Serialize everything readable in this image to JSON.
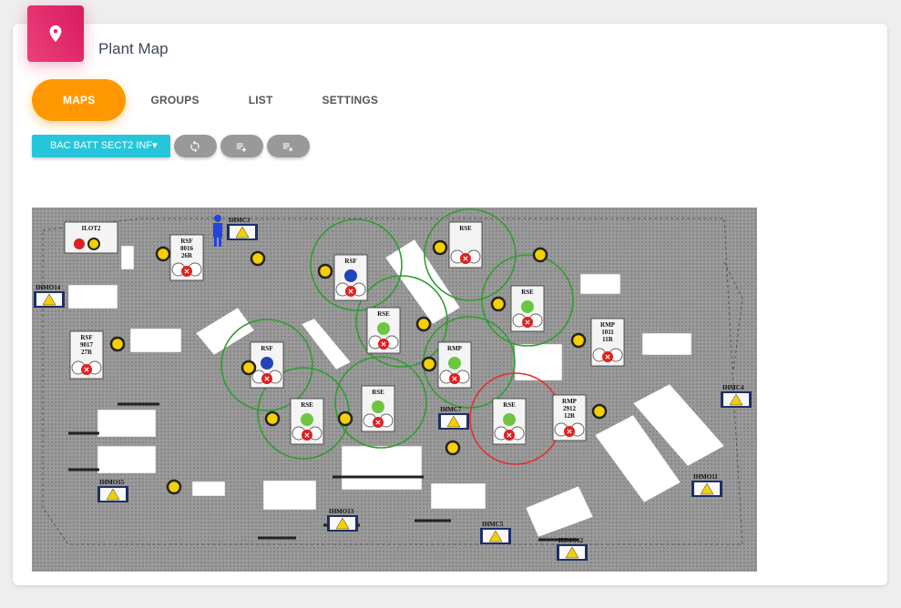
{
  "header": {
    "title": "Plant Map",
    "icon": "map-marker-icon",
    "accent": "#e91e63"
  },
  "tabs": [
    {
      "label": "MAPS",
      "active": true
    },
    {
      "label": "GROUPS",
      "active": false
    },
    {
      "label": "LIST",
      "active": false
    },
    {
      "label": "SETTINGS",
      "active": false
    }
  ],
  "toolbar": {
    "area_selected": "BAC BATT SECT2 INF",
    "buttons": [
      "refresh-icon",
      "list-add-icon",
      "list-clear-icon"
    ]
  },
  "colors": {
    "tab_active": "#ff9800",
    "dropdown": "#26c6da",
    "ring_ok": "#2e9e2e",
    "ring_alarm": "#e03030"
  },
  "map": {
    "hmi_panels": [
      "IHMC3",
      "IHMO14",
      "IHMC4",
      "IHMC7",
      "IHMO15",
      "IHMO11",
      "IHMO13",
      "IHMC5",
      "IHMO12"
    ],
    "stations": [
      {
        "label": "ILOT2",
        "l2": "",
        "l3": ""
      },
      {
        "label": "RSF",
        "l2": "8016",
        "l3": "26R"
      },
      {
        "label": "RSF",
        "l2": "",
        "l3": ""
      },
      {
        "label": "RSE",
        "l2": "",
        "l3": ""
      },
      {
        "label": "RSE",
        "l2": "",
        "l3": ""
      },
      {
        "label": "RSF",
        "l2": "9017",
        "l3": "27R"
      },
      {
        "label": "RSF",
        "l2": "",
        "l3": ""
      },
      {
        "label": "RSE",
        "l2": "",
        "l3": ""
      },
      {
        "label": "RMP",
        "l2": "",
        "l3": ""
      },
      {
        "label": "RMP",
        "l2": "1011",
        "l3": "11R"
      },
      {
        "label": "RSE",
        "l2": "",
        "l3": ""
      },
      {
        "label": "RSE",
        "l2": "",
        "l3": ""
      },
      {
        "label": "RSE",
        "l2": "",
        "l3": ""
      },
      {
        "label": "RMP",
        "l2": "2912",
        "l3": "12R"
      }
    ]
  }
}
